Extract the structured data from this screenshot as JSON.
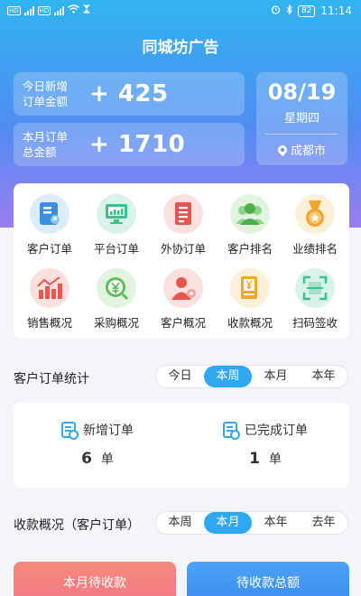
{
  "status_bar": {
    "time": "11:14",
    "battery": "82",
    "hd": "HD"
  },
  "app_title": "同城坊广告",
  "stats": [
    {
      "label_line1": "今日新增",
      "label_line2": "订单金额",
      "value": "+ 425"
    },
    {
      "label_line1": "本月订单",
      "label_line2": "总金额",
      "value": "+ 1710"
    }
  ],
  "date_card": {
    "date": "08/19",
    "weekday": "星期四",
    "city": "成都市"
  },
  "menu": [
    {
      "label": "客户订单",
      "icon": "customer-order-icon",
      "color": "#3a8fe0"
    },
    {
      "label": "平台订单",
      "icon": "platform-order-icon",
      "color": "#3fc08a"
    },
    {
      "label": "外协订单",
      "icon": "outsource-order-icon",
      "color": "#e8544e"
    },
    {
      "label": "客户排名",
      "icon": "customer-ranking-icon",
      "color": "#5cbf5a"
    },
    {
      "label": "业绩排名",
      "icon": "performance-ranking-icon",
      "color": "#f2a530"
    },
    {
      "label": "销售概况",
      "icon": "sales-overview-icon",
      "color": "#e8544e"
    },
    {
      "label": "采购概况",
      "icon": "purchase-overview-icon",
      "color": "#5cbf5a"
    },
    {
      "label": "客户概况",
      "icon": "customer-overview-icon",
      "color": "#e8544e"
    },
    {
      "label": "收款概况",
      "icon": "collection-overview-icon",
      "color": "#f2a530"
    },
    {
      "label": "扫码签收",
      "icon": "scan-sign-icon",
      "color": "#3fc08a"
    }
  ],
  "order_stats": {
    "title": "客户订单统计",
    "tabs": [
      "今日",
      "本周",
      "本月",
      "本年"
    ],
    "active_tab": "本周",
    "new_orders": {
      "label": "新增订单",
      "count": "6",
      "unit": "单"
    },
    "done_orders": {
      "label": "已完成订单",
      "count": "1",
      "unit": "单"
    }
  },
  "collection": {
    "title": "收款概况（客户订单）",
    "tabs": [
      "本周",
      "本月",
      "本年",
      "去年"
    ],
    "active_tab": "本月",
    "pending_label": "本月待收款",
    "total_label": "待收款总额"
  },
  "colors": {
    "accent": "#2fa8f1",
    "pending": "#f37d7d",
    "total": "#3f97f5"
  }
}
